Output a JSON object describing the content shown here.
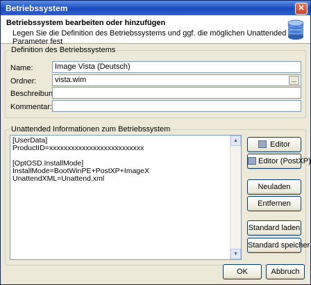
{
  "window": {
    "title": "Betriebssystem",
    "close_label": "✕"
  },
  "header": {
    "title": "Betriebssystem bearbeiten oder hinzufügen",
    "subtitle": "Legen Sie die Definition des Betriebssystems und ggf. die möglichen Unattended Parameter fest"
  },
  "definition": {
    "legend": "Definition des Betriebssystems",
    "name_label": "Name:",
    "name_value": "Image Vista (Deutsch)",
    "folder_label": "Ordner:",
    "folder_value": "vista.wim",
    "browse_label": "...",
    "description_label": "Beschreibung:",
    "description_value": "",
    "comment_label": "Kommentar:",
    "comment_value": ""
  },
  "unattended": {
    "legend": "Unattended Informationen zum Betriebssystem",
    "text": "[UserData]\nProductID=xxxxxxxxxxxxxxxxxxxxxxxxxx\n\n[OptOSD.InstallMode]\nInstallMode=BootWinPE+PostXP+ImageX\nUnattendXML=Unattend.xml",
    "buttons": {
      "editor": "Editor",
      "editor_postxp": "Editor (PostXP)",
      "reload": "Neuladen",
      "remove": "Entfernen",
      "load_default": "Standard laden",
      "save_default": "Standard speichern"
    }
  },
  "footer": {
    "ok": "OK",
    "cancel": "Abbruch"
  }
}
